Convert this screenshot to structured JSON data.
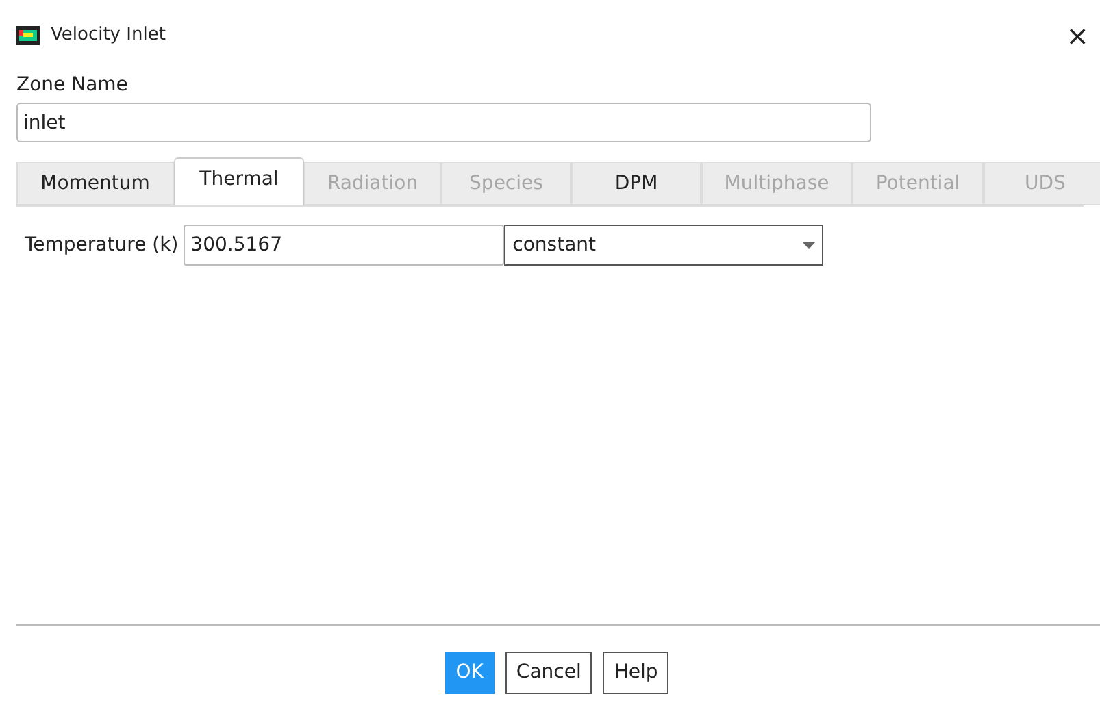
{
  "window": {
    "title": "Velocity Inlet",
    "close": "×"
  },
  "zone_name": {
    "label": "Zone Name",
    "value": "inlet"
  },
  "tabs": [
    {
      "label": "Momentum",
      "selected": false,
      "disabled": false
    },
    {
      "label": "Thermal",
      "selected": true,
      "disabled": false
    },
    {
      "label": "Radiation",
      "selected": false,
      "disabled": true
    },
    {
      "label": "Species",
      "selected": false,
      "disabled": true
    },
    {
      "label": "DPM",
      "selected": false,
      "disabled": false
    },
    {
      "label": "Multiphase",
      "selected": false,
      "disabled": true
    },
    {
      "label": "Potential",
      "selected": false,
      "disabled": true
    },
    {
      "label": "UDS",
      "selected": false,
      "disabled": true
    }
  ],
  "temperature": {
    "label": "Temperature (k)",
    "value": "300.5167",
    "method": "constant"
  },
  "buttons": [
    {
      "label": "OK",
      "kind": "primary"
    },
    {
      "label": "Cancel",
      "kind": "normal"
    },
    {
      "label": "Help",
      "kind": "normal"
    }
  ]
}
